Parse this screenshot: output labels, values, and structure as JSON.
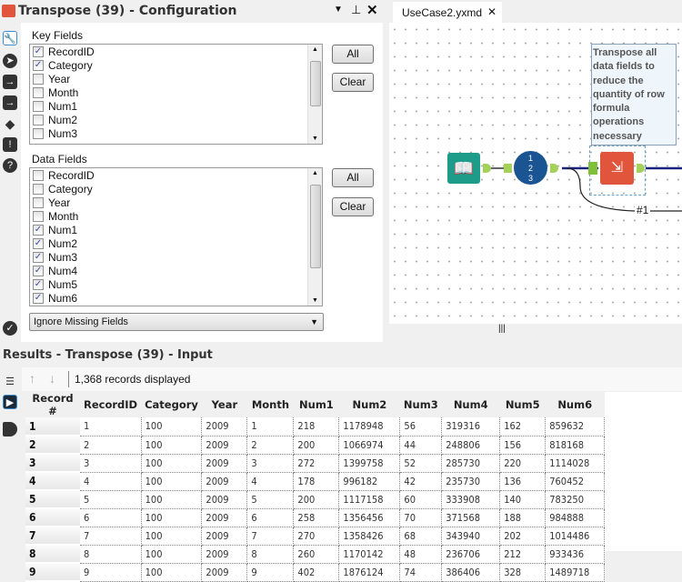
{
  "config": {
    "title": "Transpose (39) - Configuration",
    "key_fields_label": "Key Fields",
    "key_fields": [
      {
        "name": "RecordID",
        "checked": true
      },
      {
        "name": "Category",
        "checked": true
      },
      {
        "name": "Year",
        "checked": false
      },
      {
        "name": "Month",
        "checked": false
      },
      {
        "name": "Num1",
        "checked": false
      },
      {
        "name": "Num2",
        "checked": false
      },
      {
        "name": "Num3",
        "checked": false
      }
    ],
    "data_fields_label": "Data Fields",
    "data_fields": [
      {
        "name": "RecordID",
        "checked": false
      },
      {
        "name": "Category",
        "checked": false
      },
      {
        "name": "Year",
        "checked": false
      },
      {
        "name": "Month",
        "checked": false
      },
      {
        "name": "Num1",
        "checked": true
      },
      {
        "name": "Num2",
        "checked": true
      },
      {
        "name": "Num3",
        "checked": true
      },
      {
        "name": "Num4",
        "checked": true
      },
      {
        "name": "Num5",
        "checked": true
      },
      {
        "name": "Num6",
        "checked": true
      }
    ],
    "all_label": "All",
    "clear_label": "Clear",
    "missing_fields_option": "Ignore Missing Fields"
  },
  "canvas": {
    "tab": "UseCase2.yxmd",
    "comment": "Transpose all data fields to reduce the quantity of row formula operations necessary",
    "connection_label": "#1"
  },
  "results": {
    "title": "Results - Transpose (39) - Input",
    "records_displayed": "1,368 records displayed",
    "columns": [
      "Record #",
      "RecordID",
      "Category",
      "Year",
      "Month",
      "Num1",
      "Num2",
      "Num3",
      "Num4",
      "Num5",
      "Num6"
    ],
    "rows": [
      [
        "1",
        "1",
        "100",
        "2009",
        "1",
        "218",
        "1178948",
        "56",
        "319316",
        "162",
        "859632"
      ],
      [
        "2",
        "2",
        "100",
        "2009",
        "2",
        "200",
        "1066974",
        "44",
        "248806",
        "156",
        "818168"
      ],
      [
        "3",
        "3",
        "100",
        "2009",
        "3",
        "272",
        "1399758",
        "52",
        "285730",
        "220",
        "1114028"
      ],
      [
        "4",
        "4",
        "100",
        "2009",
        "4",
        "178",
        "996182",
        "42",
        "235730",
        "136",
        "760452"
      ],
      [
        "5",
        "5",
        "100",
        "2009",
        "5",
        "200",
        "1117158",
        "60",
        "333908",
        "140",
        "783250"
      ],
      [
        "6",
        "6",
        "100",
        "2009",
        "6",
        "258",
        "1356456",
        "70",
        "371568",
        "188",
        "984888"
      ],
      [
        "7",
        "7",
        "100",
        "2009",
        "7",
        "270",
        "1358426",
        "68",
        "343940",
        "202",
        "1014486"
      ],
      [
        "8",
        "8",
        "100",
        "2009",
        "8",
        "260",
        "1170142",
        "48",
        "236706",
        "212",
        "933436"
      ],
      [
        "9",
        "9",
        "100",
        "2009",
        "9",
        "402",
        "1876124",
        "74",
        "386406",
        "328",
        "1489718"
      ]
    ]
  }
}
